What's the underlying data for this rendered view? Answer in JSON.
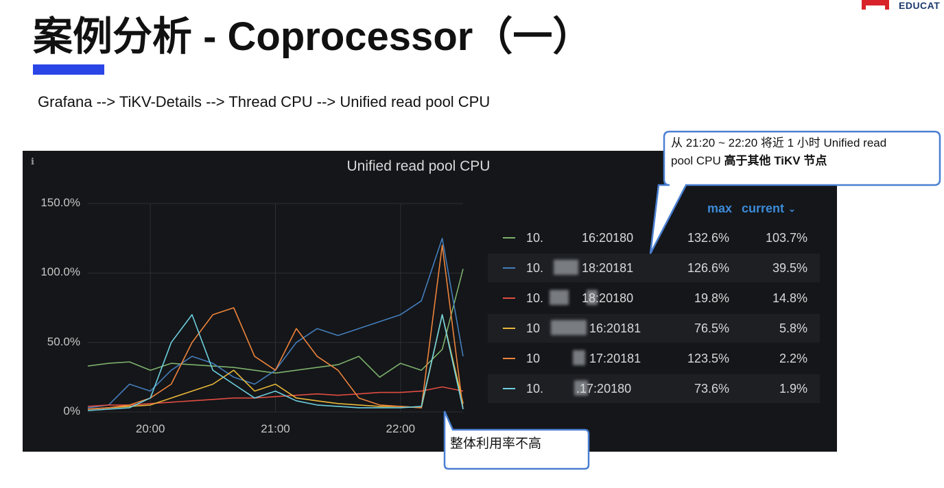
{
  "brand": {
    "text": "EDUCAT",
    "color": "#d8222a"
  },
  "slide": {
    "title": "案例分析 - Coprocessor（一）",
    "breadcrumb": "Grafana --> TiKV-Details --> Thread CPU --> Unified read pool CPU"
  },
  "panel": {
    "title": "Unified read pool CPU",
    "info_icon": "info-icon",
    "legend_headers": {
      "max": "max",
      "current": "current"
    },
    "legend": [
      {
        "name_left": "10.",
        "name_right": "16:20180",
        "max": "132.6%",
        "current": "103.7%",
        "color": "#7eb26d"
      },
      {
        "name_left": "10.",
        "name_right": "18:20181",
        "max": "126.6%",
        "current": "39.5%",
        "color": "#447ebc"
      },
      {
        "name_left": "10.",
        "name_right": "18:20180",
        "max": "19.8%",
        "current": "14.8%",
        "color": "#e24d42"
      },
      {
        "name_left": "10",
        "name_right": "16:20181",
        "max": "76.5%",
        "current": "5.8%",
        "color": "#eab839"
      },
      {
        "name_left": "10",
        "name_right": "17:20181",
        "max": "123.5%",
        "current": "2.2%",
        "color": "#ef843c"
      },
      {
        "name_left": "10.",
        "name_right": ".17:20180",
        "max": "73.6%",
        "current": "1.9%",
        "color": "#6ed0e0"
      }
    ]
  },
  "callouts": {
    "top_line1": "从 21:20 ~ 22:20 将近 1 小时 Unified read",
    "top_line2_a": "pool CPU ",
    "top_line2_b": "高于其他 TiKV 节点",
    "bottom": "整体利用率不高"
  },
  "chart_data": {
    "type": "line",
    "title": "Unified read pool CPU",
    "xlabel": "",
    "ylabel": "",
    "x_ticks": [
      "20:00",
      "21:00",
      "22:00"
    ],
    "y_ticks": [
      "150.0%",
      "100.0%",
      "50.0%",
      "0%"
    ],
    "ylim": [
      0,
      150
    ],
    "grid": true,
    "legend_placement": "right",
    "x": [
      "19:30",
      "19:40",
      "19:50",
      "20:00",
      "20:10",
      "20:20",
      "20:30",
      "20:40",
      "20:50",
      "21:00",
      "21:10",
      "21:20",
      "21:30",
      "21:40",
      "21:50",
      "22:00",
      "22:10",
      "22:20",
      "22:30"
    ],
    "series": [
      {
        "name": "10.…16:20180",
        "color": "#7eb26d",
        "values": [
          33,
          35,
          36,
          30,
          35,
          34,
          33,
          32,
          30,
          28,
          30,
          32,
          34,
          40,
          25,
          35,
          30,
          45,
          103
        ]
      },
      {
        "name": "10.…18:20181",
        "color": "#447ebc",
        "values": [
          3,
          5,
          20,
          15,
          30,
          40,
          35,
          25,
          20,
          30,
          50,
          60,
          55,
          60,
          65,
          70,
          80,
          125,
          40
        ]
      },
      {
        "name": "10.…18:20180",
        "color": "#e24d42",
        "values": [
          4,
          5,
          5,
          6,
          7,
          8,
          9,
          10,
          10,
          11,
          12,
          13,
          12,
          13,
          14,
          14,
          15,
          18,
          15
        ]
      },
      {
        "name": "10…16:20181",
        "color": "#eab839",
        "values": [
          2,
          3,
          4,
          5,
          10,
          15,
          20,
          30,
          15,
          20,
          10,
          8,
          6,
          5,
          4,
          4,
          3,
          70,
          6
        ]
      },
      {
        "name": "10…17:20181",
        "color": "#ef843c",
        "values": [
          2,
          3,
          5,
          10,
          20,
          50,
          70,
          75,
          40,
          30,
          60,
          40,
          30,
          10,
          5,
          4,
          3,
          120,
          2
        ]
      },
      {
        "name": "10.…17:20180",
        "color": "#6ed0e0",
        "values": [
          1,
          2,
          3,
          10,
          50,
          70,
          30,
          20,
          10,
          15,
          8,
          5,
          4,
          3,
          3,
          3,
          4,
          70,
          2
        ]
      }
    ]
  }
}
